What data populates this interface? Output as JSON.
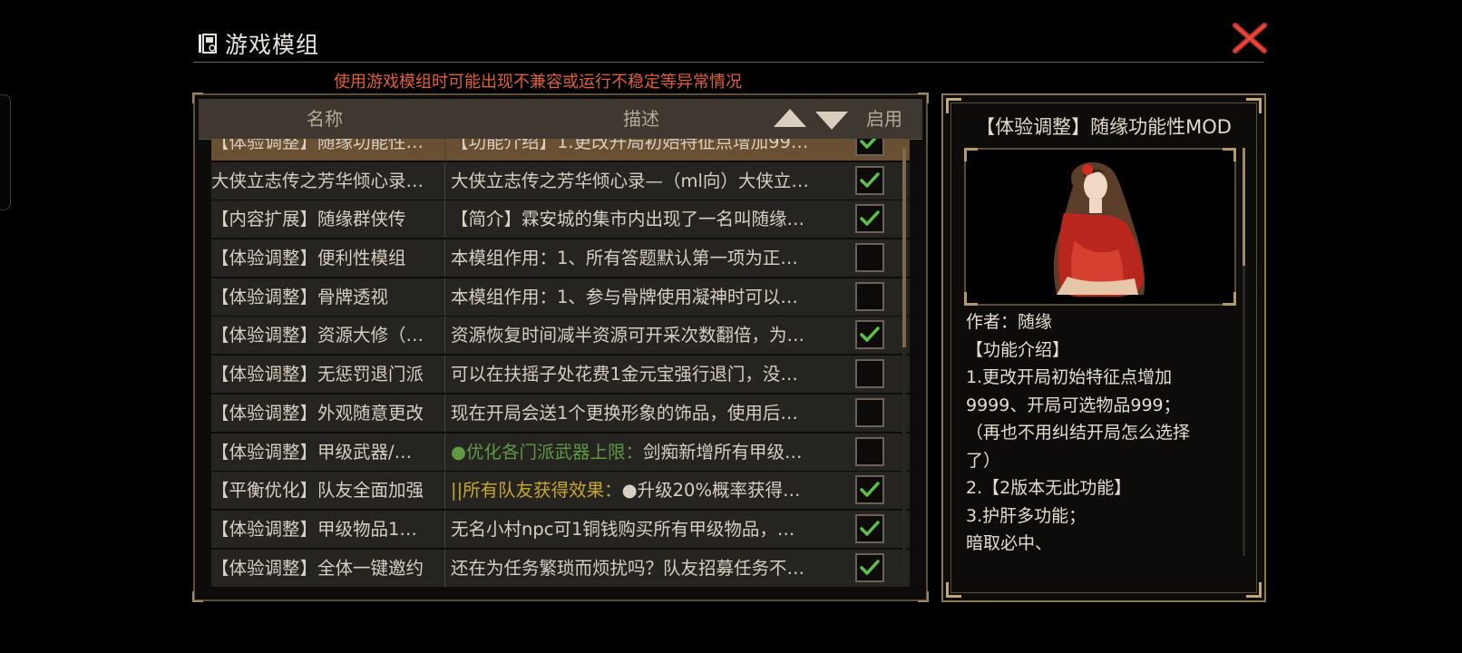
{
  "header": {
    "title": "游戏模组",
    "warning": "使用游戏模组时可能出现不兼容或运行不稳定等异常情况"
  },
  "list": {
    "columns": {
      "name": "名称",
      "description": "描述",
      "enable": "启用"
    },
    "rows": [
      {
        "name": "【体验调整】随缘功能性…",
        "desc": "【功能介绍】1.更改开局初始特征点增加99…",
        "desc_hl": "",
        "hl": "",
        "enabled": true,
        "selected": true
      },
      {
        "name": "大侠立志传之芳华倾心录…",
        "desc": "大侠立志传之芳华倾心录—（ml向）大侠立…",
        "desc_hl": "",
        "hl": "",
        "enabled": true,
        "selected": false
      },
      {
        "name": "【内容扩展】随缘群侠传",
        "desc": "【简介】霖安城的集市内出现了一名叫随缘…",
        "desc_hl": "",
        "hl": "",
        "enabled": true,
        "selected": false
      },
      {
        "name": "【体验调整】便利性模组",
        "desc": "本模组作用：1、所有答题默认第一项为正…",
        "desc_hl": "",
        "hl": "",
        "enabled": false,
        "selected": false
      },
      {
        "name": "【体验调整】骨牌透视",
        "desc": "本模组作用：1、参与骨牌使用凝神时可以…",
        "desc_hl": "",
        "hl": "",
        "enabled": false,
        "selected": false
      },
      {
        "name": "【体验调整】资源大修（…",
        "desc": "资源恢复时间减半资源可开采次数翻倍，为…",
        "desc_hl": "",
        "hl": "",
        "enabled": true,
        "selected": false
      },
      {
        "name": "【体验调整】无惩罚退门派",
        "desc": "可以在扶摇子处花费1金元宝强行退门，没…",
        "desc_hl": "",
        "hl": "",
        "enabled": false,
        "selected": false
      },
      {
        "name": "【体验调整】外观随意更改",
        "desc": "现在开局会送1个更换形象的饰品，使用后…",
        "desc_hl": "",
        "hl": "",
        "enabled": false,
        "selected": false
      },
      {
        "name": "【体验调整】甲级武器/…",
        "desc_hl": "●优化各门派武器上限：",
        "hl": "green",
        "desc": "剑痴新增所有甲级…",
        "enabled": false,
        "selected": false
      },
      {
        "name": "【平衡优化】队友全面加强",
        "desc_hl": "||所有队友获得效果：",
        "hl": "yellow",
        "desc": "●升级20%概率获得…",
        "enabled": true,
        "selected": false
      },
      {
        "name": "【体验调整】甲级物品1…",
        "desc": "无名小村npc可1铜钱购买所有甲级物品，…",
        "desc_hl": "",
        "hl": "",
        "enabled": true,
        "selected": false
      },
      {
        "name": "【体验调整】全体一键邀约",
        "desc": "还在为任务繁琐而烦扰吗？队友招募任务不…",
        "desc_hl": "",
        "hl": "",
        "enabled": true,
        "selected": false
      }
    ]
  },
  "detail": {
    "title": "【体验调整】随缘功能性MOD",
    "lines": [
      "作者：随缘",
      "【功能介绍】",
      "1.更改开局初始特征点增加",
      "9999、开局可选物品999；",
      "（再也不用纠结开局怎么选择",
      "了）",
      "2.【2版本无此功能】",
      "3.护肝多功能；",
      "暗取必中、"
    ]
  },
  "colors": {
    "accent": "#e0603a",
    "check": "#5ec04a",
    "selected_row": "#6a5032"
  }
}
